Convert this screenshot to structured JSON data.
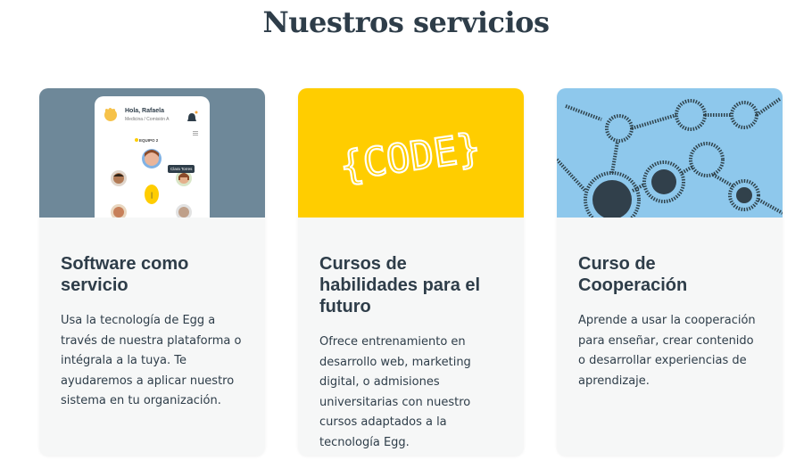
{
  "section": {
    "title": "Nuestros servicios"
  },
  "cards": [
    {
      "title": "Software como servicio",
      "text": "Usa la tecnología de Egg a través de nuestra plataforma o intégrala a la tuya. Te ayudaremos a aplicar nuestro sistema en tu organización.",
      "image": {
        "greeting": "Hola, Rafaela",
        "subtitle": "Medicina / Comisión A",
        "team": "EQUIPO 2",
        "tag": "Clara Torres"
      }
    },
    {
      "title": "Cursos de habilidades para el futuro",
      "text": "Ofrece entrenamiento en desarrollo web, marketing digital, o admisiones universitarias con nuestro cursos adaptados a la tecnología Egg.",
      "image": {
        "code_text": "{CODE}"
      }
    },
    {
      "title": "Curso de Cooperación",
      "text": "Aprende a usar la cooperación para enseñar, crear contenido o desarrollar experiencias de aprendizaje."
    }
  ],
  "colors": {
    "heading": "#2e3d49",
    "card_bg": "#f6f7f7",
    "code_yellow": "#ffcd00",
    "app_bg": "#6e8899",
    "sky_blue": "#8ec8ec"
  }
}
